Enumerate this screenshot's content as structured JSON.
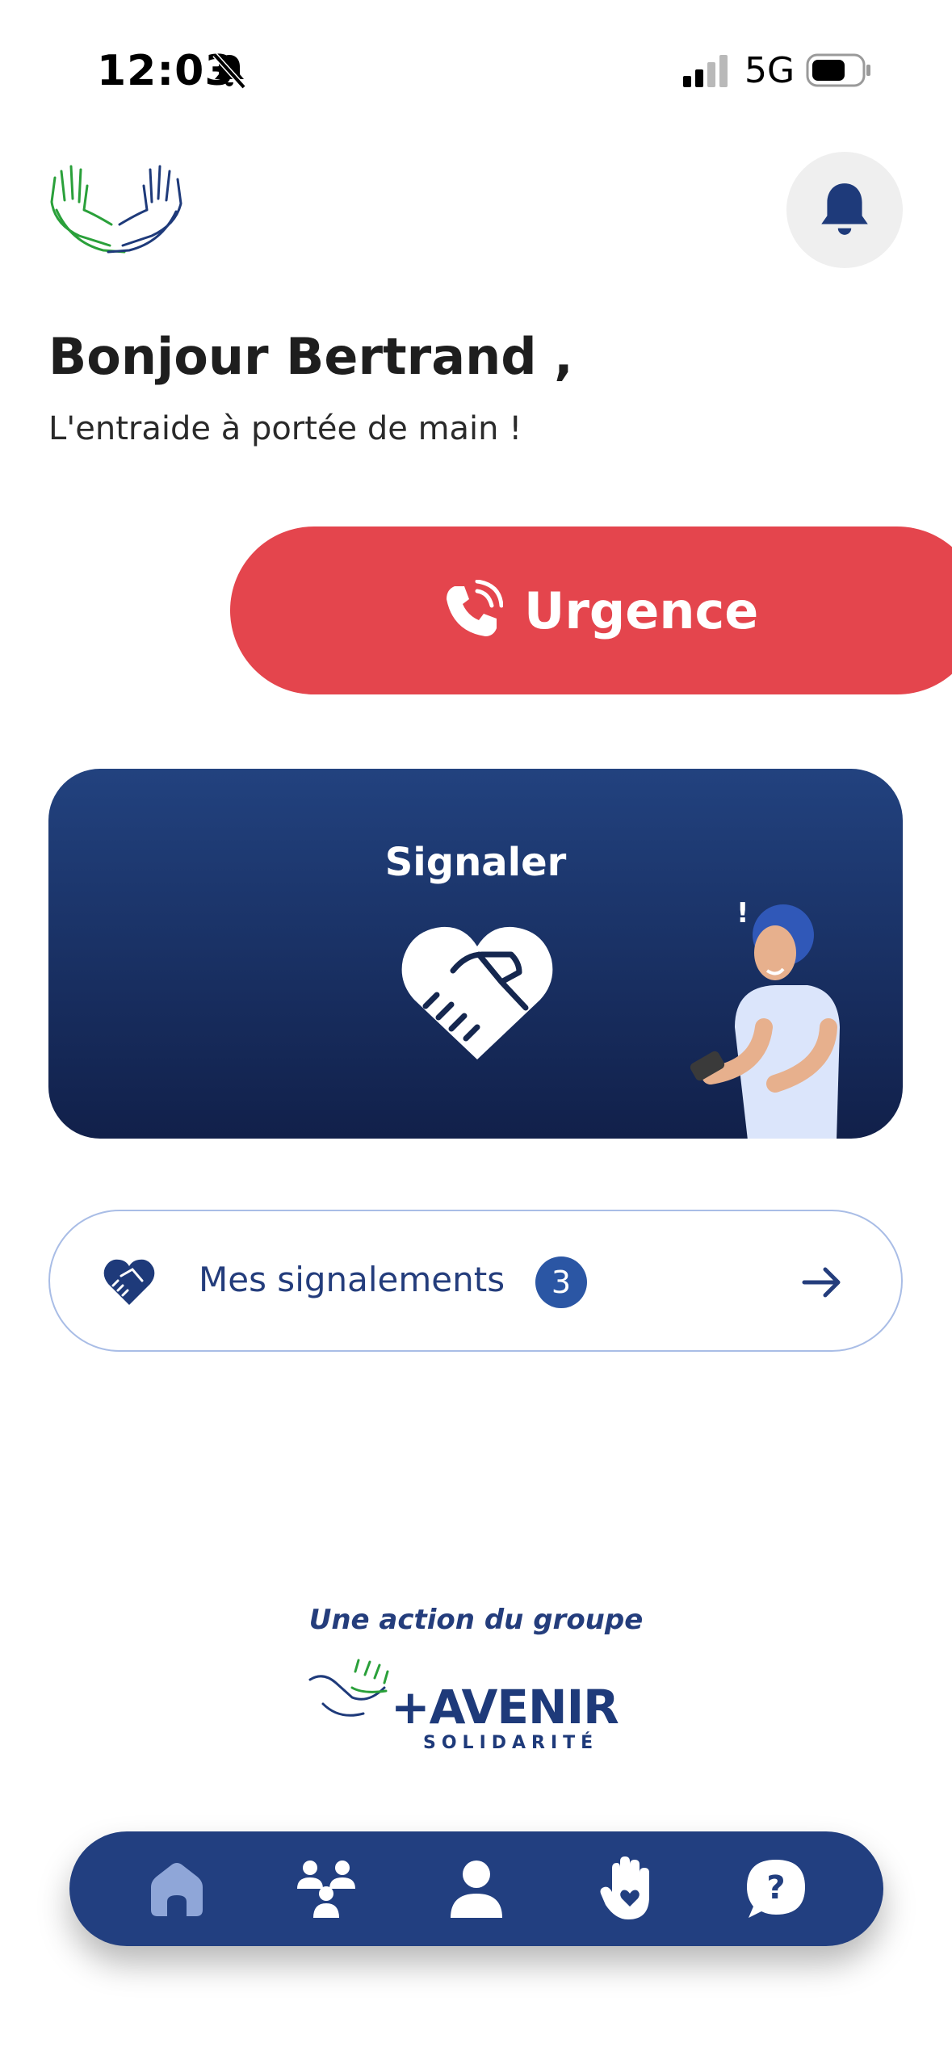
{
  "status_bar": {
    "time": "12:03",
    "network": "5G"
  },
  "header": {
    "greeting": "Bonjour Bertrand ,",
    "tagline": "L'entraide à portée de main !"
  },
  "urgence": {
    "label": "Urgence"
  },
  "signaler": {
    "title": "Signaler"
  },
  "signalements": {
    "label": "Mes signalements",
    "count": "3"
  },
  "footer": {
    "caption": "Une action du groupe",
    "brand_name": "+AVENIR",
    "brand_sub": "SOLIDARITÉ"
  },
  "bottom_nav": {
    "items": [
      {
        "icon": "home-icon",
        "active": true
      },
      {
        "icon": "group-icon",
        "active": false
      },
      {
        "icon": "user-icon",
        "active": false
      },
      {
        "icon": "hand-heart-icon",
        "active": false
      },
      {
        "icon": "help-icon",
        "active": false
      }
    ]
  },
  "colors": {
    "urgence": "#e4454d",
    "primary": "#223f80",
    "accent_blue": "#2b56a4",
    "nav_active": "#8fa6d8"
  }
}
